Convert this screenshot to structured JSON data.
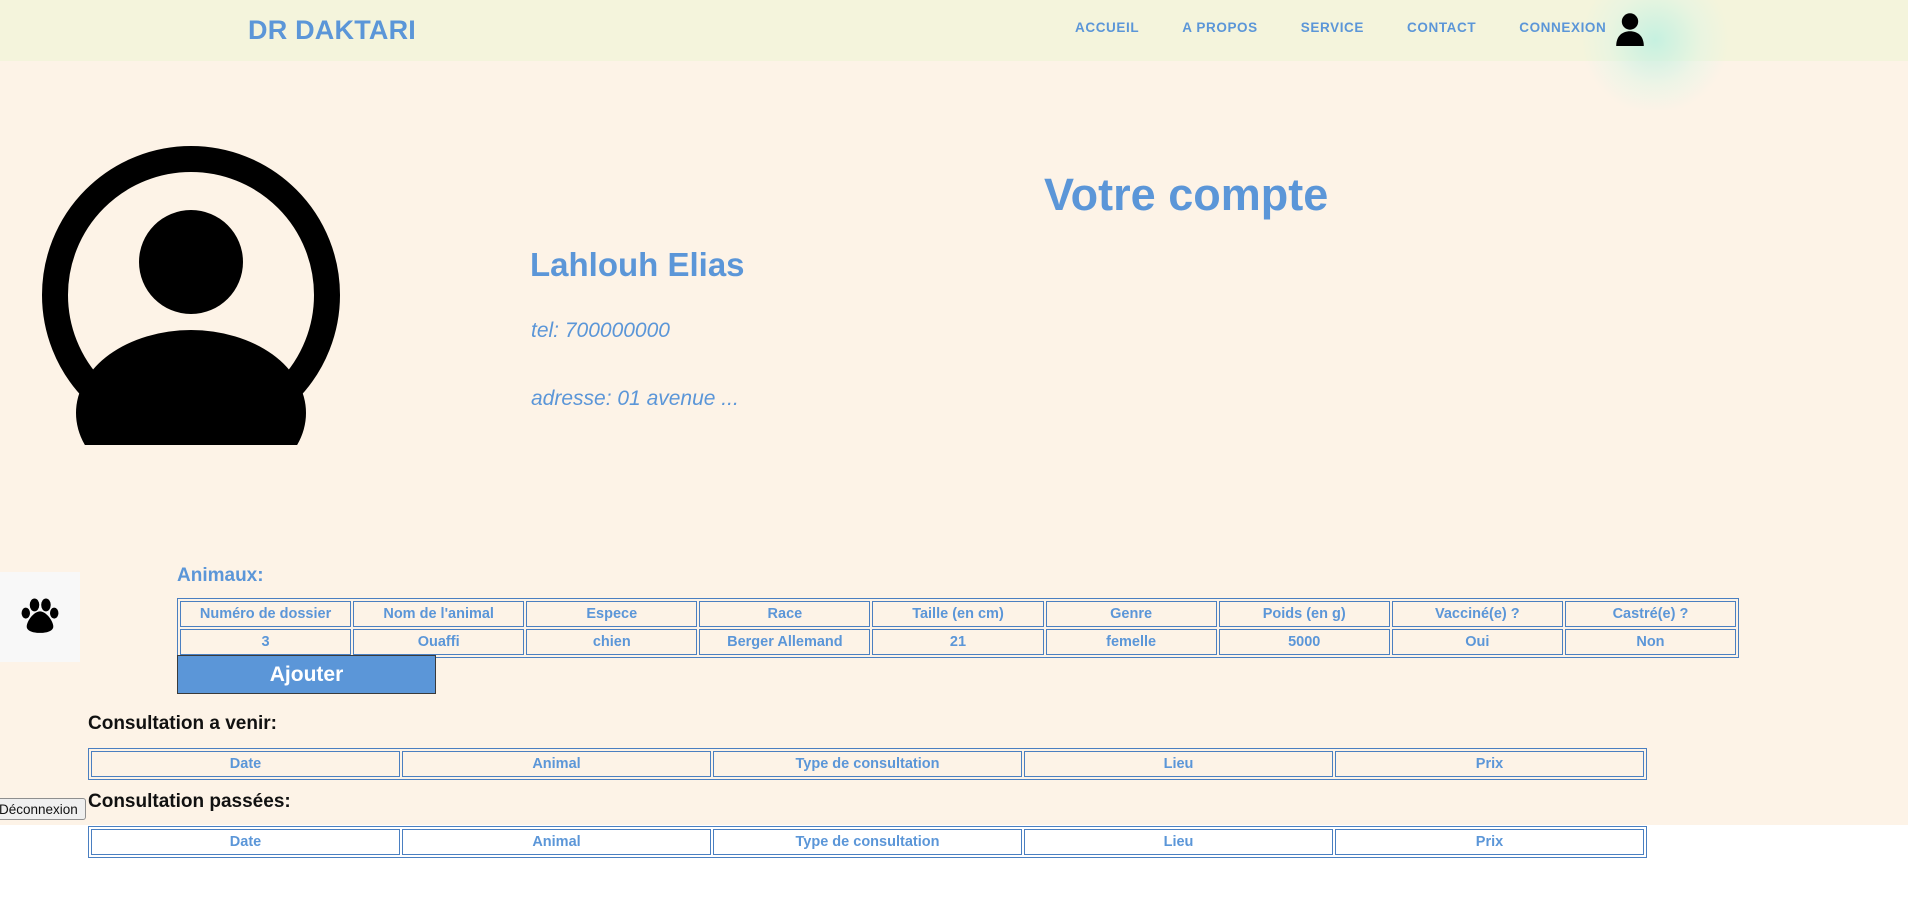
{
  "header": {
    "brand": "DR DAKTARI",
    "nav_items": [
      {
        "label": "ACCUEIL",
        "name": "nav-link-accueil"
      },
      {
        "label": "A PROPOS",
        "name": "nav-link-a-propos"
      },
      {
        "label": "SERVICE",
        "name": "nav-link-service"
      },
      {
        "label": "CONTACT",
        "name": "nav-link-contact"
      },
      {
        "label": "CONNEXION",
        "name": "nav-link-connexion"
      }
    ],
    "avatar_icon": "user-avatar-icon",
    "background_color": "#f4f4dc",
    "accent_color": "#5b96d8"
  },
  "profile": {
    "avatar_icon": "user-circle-icon",
    "page_title": "Votre compte",
    "name": "Lahlouh Elias",
    "tel": "tel: 700000000",
    "address": "adresse: 01 avenue ..."
  },
  "paw_badge": {
    "icon": "paw-print-icon"
  },
  "animals": {
    "label": "Animaux:",
    "columns": [
      "Numéro de dossier",
      "Nom de l'animal",
      "Espece",
      "Race",
      "Taille (en cm)",
      "Genre",
      "Poids (en g)",
      "Vacciné(e) ?",
      "Castré(e) ?"
    ],
    "rows": [
      [
        "3",
        "Ouaffi",
        "chien",
        "Berger Allemand",
        "21",
        "femelle",
        "5000",
        "Oui",
        "Non"
      ]
    ],
    "add_button_label": "Ajouter"
  },
  "upcoming_consultations": {
    "label": "Consultation a venir:",
    "columns": [
      "Date",
      "Animal",
      "Type de consultation",
      "Lieu",
      "Prix"
    ],
    "rows": []
  },
  "past_consultations": {
    "label": "Consultation passées:",
    "columns": [
      "Date",
      "Animal",
      "Type de consultation",
      "Lieu",
      "Prix"
    ],
    "rows": []
  },
  "footer": {
    "logout_label": "Déconnexion"
  },
  "colors": {
    "accent_blue": "#5b96d8",
    "border_blue": "#4a7fc1",
    "page_background": "#fdf3e7",
    "navbar_background": "#f4f4dc"
  }
}
